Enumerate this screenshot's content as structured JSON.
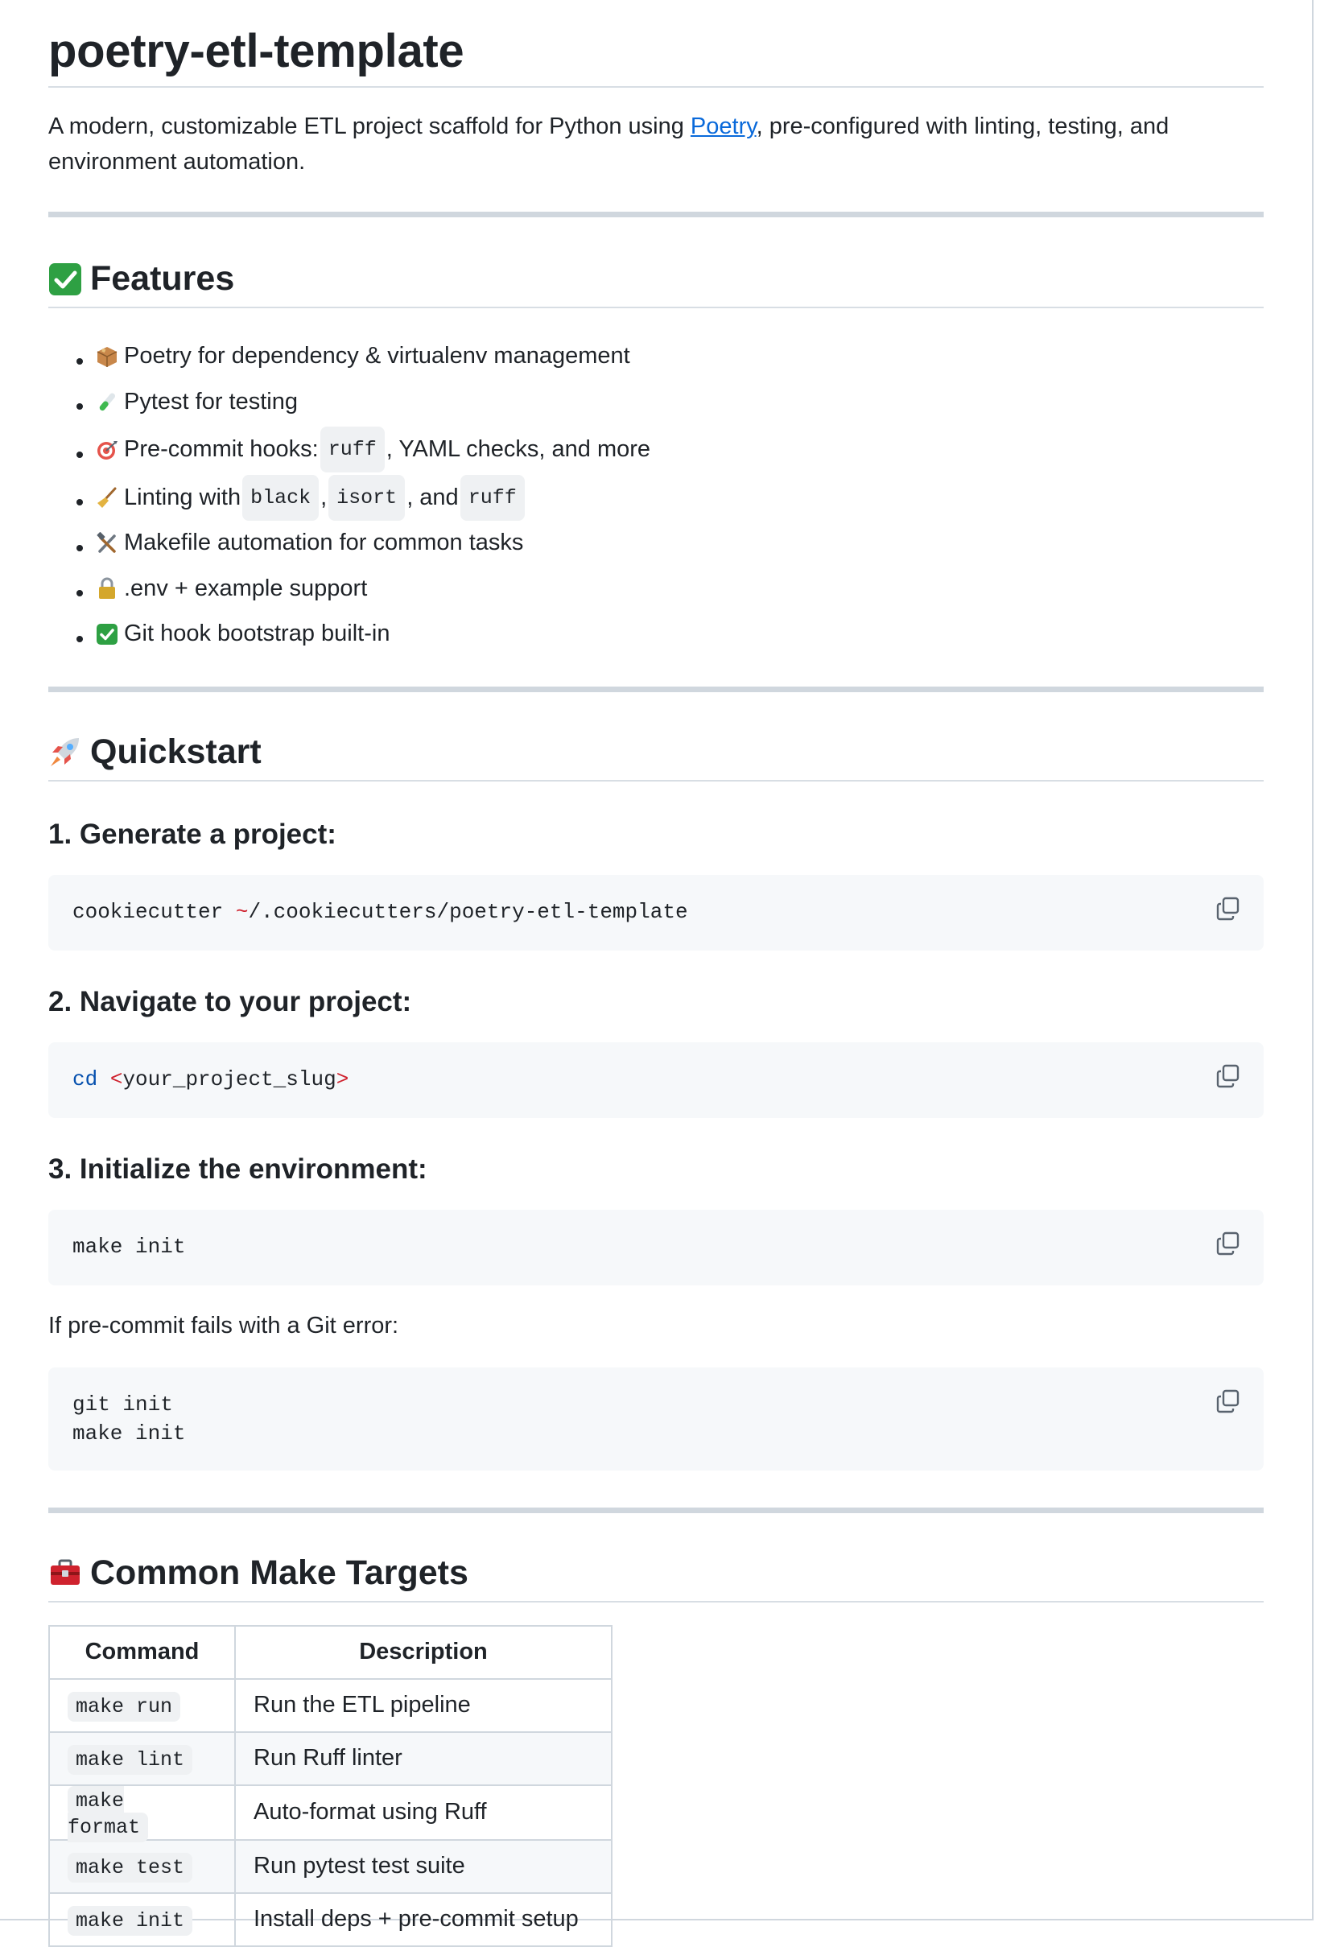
{
  "title": "poetry-etl-template",
  "intro": {
    "before": "A modern, customizable ETL project scaffold for Python using ",
    "link": "Poetry",
    "after": ", pre-configured with linting, testing, and environment automation."
  },
  "features": {
    "heading": "Features",
    "icon": "check-mark-emoji",
    "items": [
      {
        "icon": "package-emoji",
        "text": "Poetry for dependency & virtualenv management"
      },
      {
        "icon": "test-tube-emoji",
        "text": "Pytest for testing"
      },
      {
        "icon": "target-emoji",
        "pre": "Pre-commit hooks: ",
        "code1": "ruff",
        "post": ", YAML checks, and more"
      },
      {
        "icon": "broom-emoji",
        "pre": "Linting with ",
        "code1": "black",
        "mid1": ", ",
        "code2": "isort",
        "mid2": ", and ",
        "code3": "ruff"
      },
      {
        "icon": "tools-emoji",
        "text": "Makefile automation for common tasks"
      },
      {
        "icon": "lock-emoji",
        "text": ".env + example support"
      },
      {
        "icon": "check-mark-emoji",
        "text": "Git hook bootstrap built-in"
      }
    ]
  },
  "quickstart": {
    "heading": "Quickstart",
    "icon": "rocket-emoji",
    "step1": {
      "title": "1. Generate a project:",
      "cmd": "cookiecutter ",
      "tilde": "~",
      "path": "/.cookiecutters/poetry-etl-template"
    },
    "step2": {
      "title": "2. Navigate to your project:",
      "kw": "cd",
      "lt": "<",
      "arg": "your_project_slug",
      "gt": ">"
    },
    "step3": {
      "title": "3. Initialize the environment:",
      "cmd": "make init"
    },
    "note": "If pre-commit fails with a Git error:",
    "fallback": {
      "line1": "git init",
      "line2": "make init"
    }
  },
  "targets": {
    "heading": "Common Make Targets",
    "icon": "toolbox-emoji",
    "headers": {
      "command": "Command",
      "description": "Description"
    },
    "rows": [
      {
        "command": "make run",
        "description": "Run the ETL pipeline"
      },
      {
        "command": "make lint",
        "description": "Run Ruff linter"
      },
      {
        "command": "make format",
        "description": "Auto-format using Ruff"
      },
      {
        "command": "make test",
        "description": "Run pytest test suite"
      },
      {
        "command": "make init",
        "description": "Install deps + pre-commit setup"
      }
    ]
  }
}
